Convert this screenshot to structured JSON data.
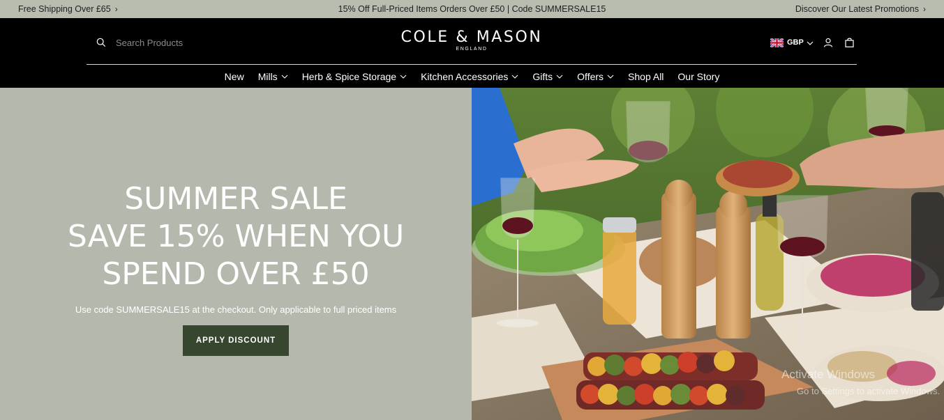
{
  "announcement": {
    "left": "Free Shipping Over £65",
    "center": "15% Off Full-Priced Items Orders Over £50 | Code SUMMERSALE15",
    "right": "Discover Our Latest Promotions"
  },
  "header": {
    "search_placeholder": "Search Products",
    "logo_main": "COLE & MASON",
    "logo_sub": "ENGLAND",
    "currency": "GBP"
  },
  "nav": {
    "items": [
      {
        "label": "New",
        "dropdown": false
      },
      {
        "label": "Mills",
        "dropdown": true
      },
      {
        "label": "Herb & Spice Storage",
        "dropdown": true
      },
      {
        "label": "Kitchen Accessories",
        "dropdown": true
      },
      {
        "label": "Gifts",
        "dropdown": true
      },
      {
        "label": "Offers",
        "dropdown": true
      },
      {
        "label": "Shop All",
        "dropdown": false
      },
      {
        "label": "Our Story",
        "dropdown": false
      }
    ]
  },
  "hero": {
    "headline_lines": [
      "SUMMER SALE",
      "SAVE 15% WHEN YOU",
      "SPEND OVER £50"
    ],
    "subtext": "Use code SUMMERSALE15 at the checkout. Only applicable to full priced items",
    "cta": "APPLY DISCOUNT"
  },
  "overlay": {
    "line1": "Activate Windows",
    "line2": "Go to Settings to activate Windows."
  },
  "colors": {
    "announce_bg": "#b9bdb0",
    "header_bg": "#000000",
    "hero_bg": "#b5b9ad",
    "cta_bg": "#37462f"
  }
}
